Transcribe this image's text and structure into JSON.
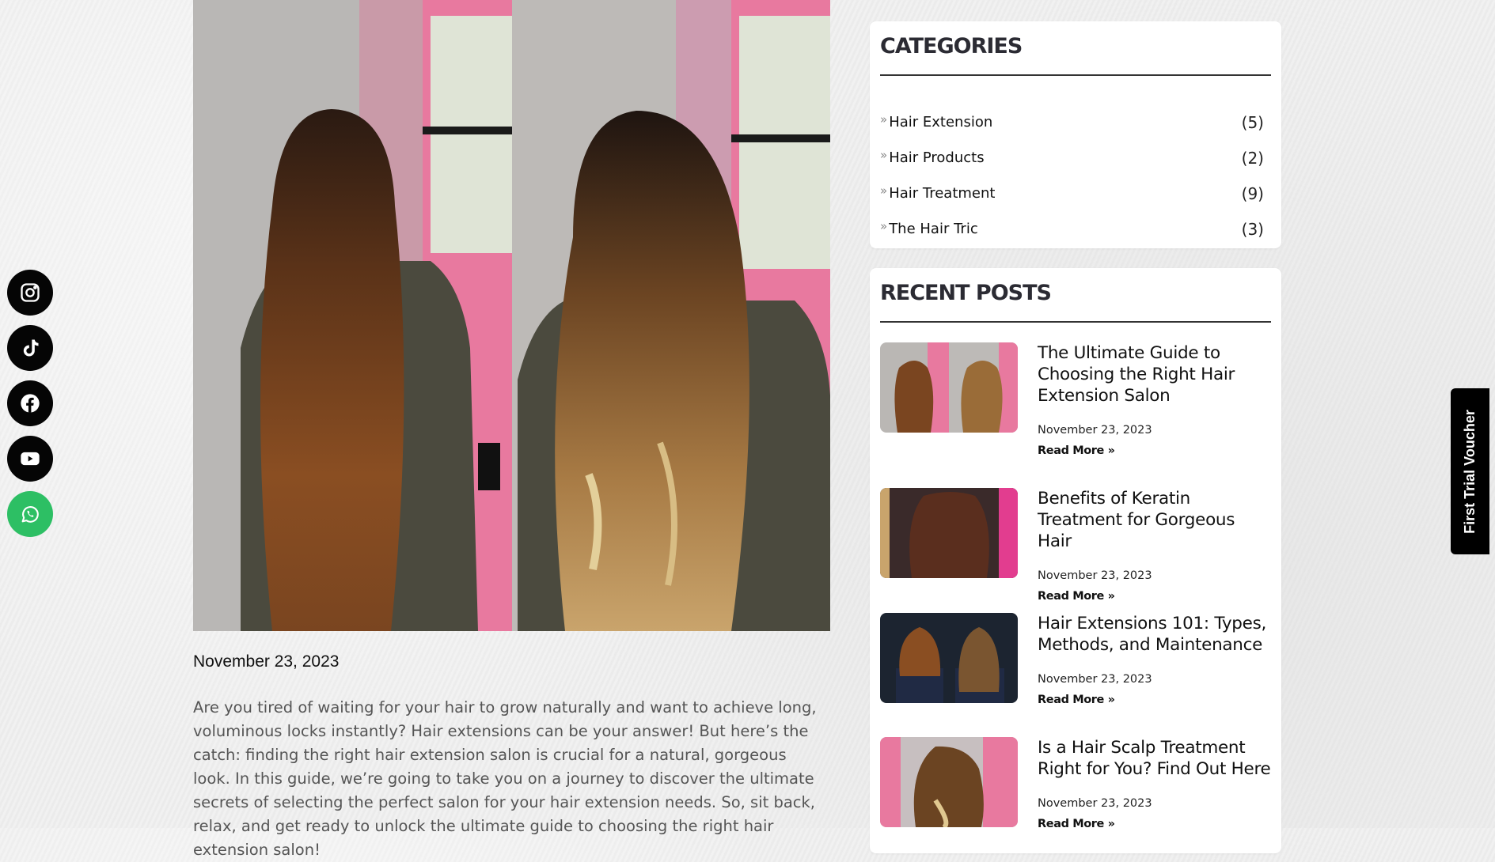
{
  "social": {
    "items": [
      {
        "name": "instagram-icon",
        "label": "Instagram"
      },
      {
        "name": "tiktok-icon",
        "label": "TikTok"
      },
      {
        "name": "facebook-icon",
        "label": "Facebook"
      },
      {
        "name": "youtube-icon",
        "label": "YouTube"
      },
      {
        "name": "whatsapp-icon",
        "label": "WhatsApp"
      }
    ]
  },
  "article": {
    "image_alt": "Before and after hair extension photo",
    "date": "November 23, 2023",
    "excerpt": "Are you tired of waiting for your hair to grow naturally and want to achieve long, voluminous locks instantly? Hair extensions can be your answer! But here’s the catch: finding the right hair extension salon is crucial for a natural, gorgeous look. In this guide, we’re going to take you on a journey to discover the ultimate secrets of selecting the perfect salon for your hair extension needs. So, sit back, relax, and get ready to unlock the ultimate guide to choosing the right hair extension salon!"
  },
  "sidebar": {
    "categories_title": "CATEGORIES",
    "categories": [
      {
        "label": "Hair Extension",
        "count": "(5)"
      },
      {
        "label": "Hair Products",
        "count": "(2)"
      },
      {
        "label": "Hair Treatment",
        "count": "(9)"
      },
      {
        "label": "The Hair Tric",
        "count": "(3)"
      }
    ],
    "recent_title": "RECENT POSTS",
    "recent_posts": [
      {
        "title": "The Ultimate Guide to Choosing the Right Hair Extension Salon",
        "date": "November 23, 2023",
        "more": "Read More »"
      },
      {
        "title": "Benefits of Keratin Treatment for Gorgeous Hair",
        "date": "November 23, 2023",
        "more": "Read More »"
      },
      {
        "title": "Hair Extensions 101: Types, Methods, and Maintenance",
        "date": "November 23, 2023",
        "more": "Read More »"
      },
      {
        "title": "Is a Hair Scalp Treatment Right for You? Find Out Here",
        "date": "November 23, 2023",
        "more": "Read More »"
      }
    ]
  },
  "voucher": {
    "label": "First Trial Voucher"
  },
  "colors": {
    "whatsapp": "#2dbf64",
    "dark": "#050505",
    "card": "#ffffff"
  }
}
